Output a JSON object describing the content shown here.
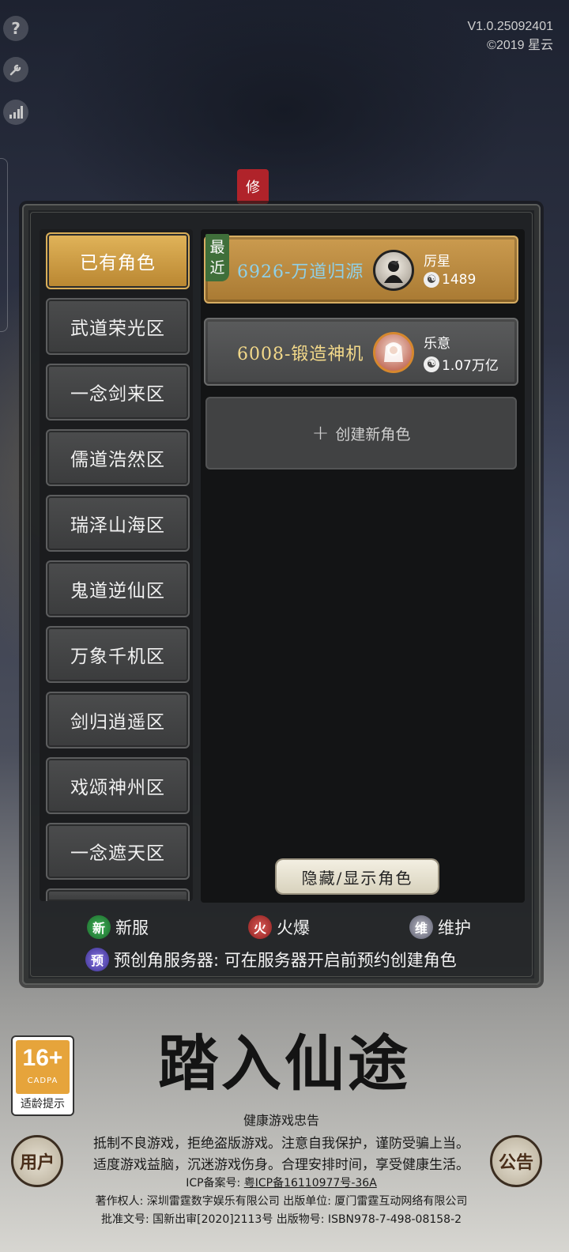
{
  "version": {
    "line1": "V1.0.25092401",
    "line2": "©2019 星云"
  },
  "tools": [
    "help-icon",
    "wrench-icon",
    "signal-icon"
  ],
  "seal_text": "修",
  "sidebar": {
    "items": [
      {
        "label": "已有角色",
        "active": true
      },
      {
        "label": "武道荣光区"
      },
      {
        "label": "一念剑来区"
      },
      {
        "label": "儒道浩然区"
      },
      {
        "label": "瑞泽山海区"
      },
      {
        "label": "鬼道逆仙区"
      },
      {
        "label": "万象千机区"
      },
      {
        "label": "剑归逍遥区"
      },
      {
        "label": "戏颂神州区"
      },
      {
        "label": "一念遮天区"
      }
    ]
  },
  "roles": [
    {
      "tag": "最近",
      "name": "6926-万道归源",
      "title": "厉星",
      "power": "1489",
      "avatar": "swordsman-avatar"
    },
    {
      "name": "6008-锻造神机",
      "title": "乐意",
      "power": "1.07万亿",
      "avatar": "white-hair-avatar"
    }
  ],
  "create_label": "创建新角色",
  "toggle_label": "隐藏/显示角色",
  "legend": {
    "new": {
      "icon": "新",
      "label": "新服"
    },
    "hot": {
      "icon": "火",
      "label": "火爆"
    },
    "maint": {
      "icon": "维",
      "label": "维护"
    },
    "pre": {
      "icon": "预",
      "label": "预创角服务器: 可在服务器开启前预约创建角色"
    }
  },
  "age_badge": {
    "num": "16+",
    "org": "CADPA",
    "label": "适龄提示"
  },
  "game_title": "踏入仙途",
  "side_buttons": {
    "left": "用户",
    "right": "公告"
  },
  "notice": {
    "title": "健康游戏忠告",
    "line1": "抵制不良游戏，拒绝盗版游戏。注意自我保护，谨防受骗上当。",
    "line2": "适度游戏益脑，沉迷游戏伤身。合理安排时间，享受健康生活。",
    "icp_prefix": "ICP备案号: ",
    "icp": "粤ICP备16110977号-36A",
    "copyright": "著作权人: 深圳雷霆数字娱乐有限公司 出版单位: 厦门雷霆互动网络有限公司",
    "approval": "批准文号: 国新出审[2020]2113号 出版物号: ISBN978-7-498-08158-2"
  }
}
